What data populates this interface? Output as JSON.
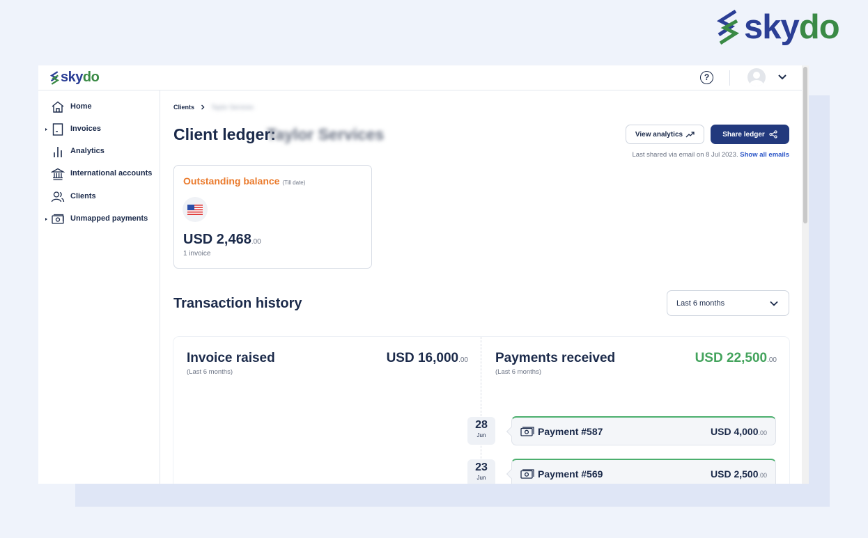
{
  "brand": {
    "name_part1": "sky",
    "name_part2": "do"
  },
  "app": {
    "logo_part1": "sky",
    "logo_part2": "do",
    "help_glyph": "?"
  },
  "sidebar": {
    "items": [
      {
        "label": "Home",
        "icon": "home-icon"
      },
      {
        "label": "Invoices",
        "icon": "invoice-icon"
      },
      {
        "label": "Analytics",
        "icon": "bar-chart-icon"
      },
      {
        "label": "International accounts",
        "icon": "bank-icon"
      },
      {
        "label": "Clients",
        "icon": "users-icon"
      },
      {
        "label": "Unmapped payments",
        "icon": "cash-icon"
      }
    ]
  },
  "breadcrumb": {
    "root": "Clients",
    "current": "Taylor Services"
  },
  "page": {
    "title": "Client ledger:",
    "client_name": "Taylor Services",
    "view_analytics": "View analytics",
    "share_ledger": "Share ledger",
    "shared_text": "Last shared via email on 8 Jul 2023.",
    "show_emails": "Show all emails"
  },
  "balance": {
    "title": "Outstanding balance",
    "subtitle": "(Till date)",
    "currency_amount": "USD 2,468",
    "cents": ".00",
    "invoices": "1 invoice"
  },
  "history": {
    "title": "Transaction history",
    "range": "Last 6 months",
    "invoice_title": "Invoice raised",
    "invoice_sub": "(Last 6 months)",
    "invoice_amount": "USD 16,000",
    "invoice_cents": ".00",
    "payments_title": "Payments received",
    "payments_sub": "(Last 6 months)",
    "payments_amount": "USD 22,500",
    "payments_cents": ".00",
    "payments": [
      {
        "day": "28",
        "month": "Jun",
        "label": "Payment #587",
        "amount": "USD 4,000",
        "cents": ".00"
      },
      {
        "day": "23",
        "month": "Jun",
        "label": "Payment #569",
        "amount": "USD 2,500",
        "cents": ".00"
      }
    ]
  },
  "colors": {
    "navy": "#22397d",
    "brand_blue": "#2b3e95",
    "brand_green": "#3a8a45",
    "orange": "#ea7a2c",
    "green_amount": "#43a35c"
  }
}
